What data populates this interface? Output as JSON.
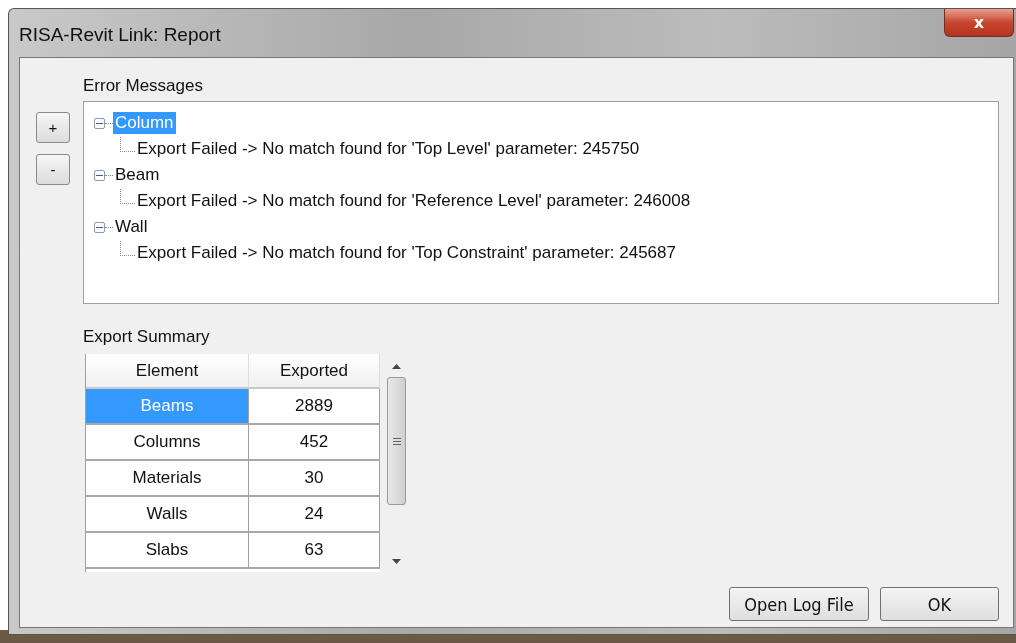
{
  "window": {
    "title": "RISA-Revit Link: Report",
    "close_label": "x"
  },
  "side_buttons": [
    "+",
    "-"
  ],
  "error_messages": {
    "label": "Error Messages",
    "nodes": [
      {
        "label": "Column",
        "expanded": true,
        "selected": true,
        "children": [
          {
            "label": "Export Failed -> No match found for 'Top Level' parameter: 245750"
          }
        ]
      },
      {
        "label": "Beam",
        "expanded": true,
        "selected": false,
        "children": [
          {
            "label": "Export Failed -> No match found for 'Reference Level' parameter: 246008"
          }
        ]
      },
      {
        "label": "Wall",
        "expanded": true,
        "selected": false,
        "children": [
          {
            "label": "Export Failed -> No match found for 'Top Constraint' parameter: 245687"
          }
        ]
      }
    ]
  },
  "export_summary": {
    "label": "Export Summary",
    "columns": [
      "Element",
      "Exported"
    ],
    "rows": [
      {
        "cells": [
          "Beams",
          "2889"
        ],
        "selected": true
      },
      {
        "cells": [
          "Columns",
          "452"
        ],
        "selected": false
      },
      {
        "cells": [
          "Materials",
          "30"
        ],
        "selected": false
      },
      {
        "cells": [
          "Walls",
          "24"
        ],
        "selected": false
      },
      {
        "cells": [
          "Slabs",
          "63"
        ],
        "selected": false
      }
    ]
  },
  "buttons": [
    "Open Log File",
    "OK"
  ]
}
